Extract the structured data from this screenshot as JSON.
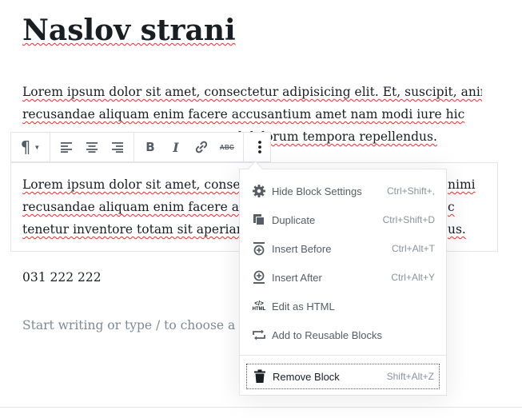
{
  "editor": {
    "title": "Naslov strani",
    "paragraph1": {
      "line1": "Lorem ipsum dolor sit amet, consectetur adipisicing elit. Et, suscipit, animi",
      "line2": "recusandae aliquam enim facere accusantium amet nam modi iure hic",
      "line3": "l dolorum tempora repellendus."
    },
    "paragraph2": {
      "line1": "Lorem ipsum dolor sit amet, consec",
      "line1_right": "nimi",
      "line2": "recusandae aliquam enim facere ac",
      "line2_right": "c",
      "line3": "tenetur inventore totam sit aperiam",
      "line3_right": "us."
    },
    "phone": "031 222 222",
    "placeholder": "Start writing or type / to choose a bl"
  },
  "toolbar": {
    "paragraph_icon": "paragraph-icon",
    "buttons": [
      "align-left-icon",
      "align-center-icon",
      "align-right-icon",
      "bold-icon",
      "italic-icon",
      "link-icon",
      "strikethrough-icon",
      "more-options-icon"
    ],
    "bold": "B",
    "italic": "I",
    "strike": "ABC"
  },
  "menu": {
    "items": [
      {
        "label": "Hide Block Settings",
        "shortcut": "Ctrl+Shift+,",
        "icon": "gear-icon"
      },
      {
        "label": "Duplicate",
        "shortcut": "Ctrl+Shift+D",
        "icon": "duplicate-icon"
      },
      {
        "label": "Insert Before",
        "shortcut": "Ctrl+Alt+T",
        "icon": "insert-before-icon"
      },
      {
        "label": "Insert After",
        "shortcut": "Ctrl+Alt+Y",
        "icon": "insert-after-icon"
      },
      {
        "label": "Edit as HTML",
        "shortcut": "",
        "icon": "html-icon"
      },
      {
        "label": "Add to Reusable Blocks",
        "shortcut": "",
        "icon": "reusable-icon"
      }
    ],
    "remove": {
      "label": "Remove Block",
      "shortcut": "Shift+Alt+Z",
      "icon": "trash-icon"
    },
    "html_icon_text": "HTML"
  }
}
